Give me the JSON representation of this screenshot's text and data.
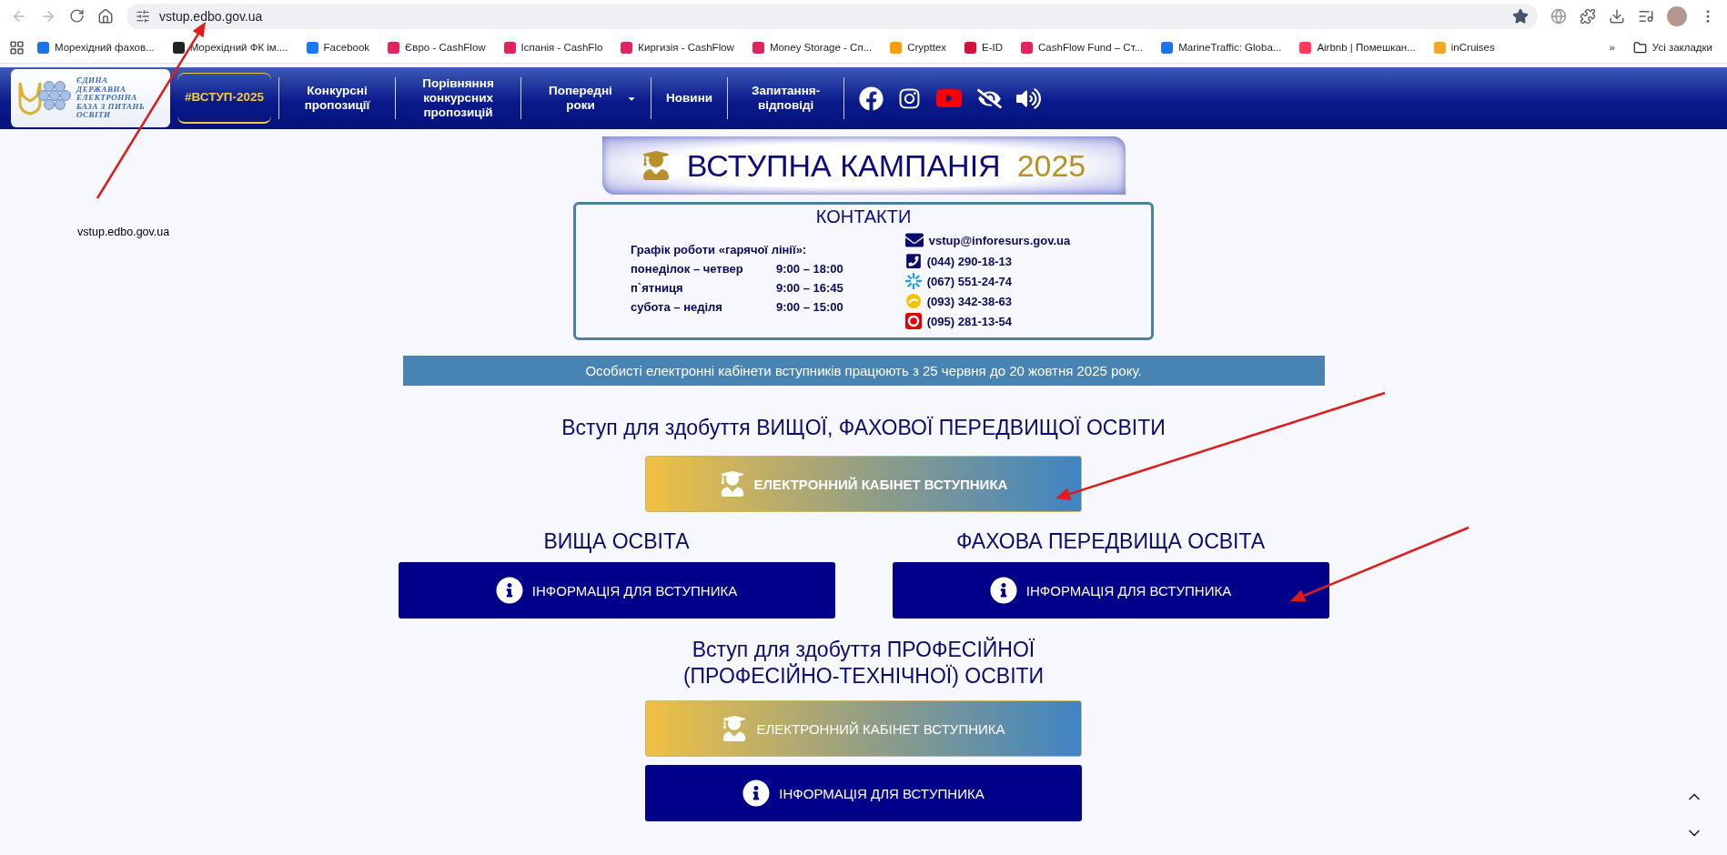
{
  "browser": {
    "url": "vstup.edbo.gov.ua",
    "bookmarks": [
      {
        "label": "Морехідний фахов...",
        "color": "#1a73e8"
      },
      {
        "label": "Морехідний ФК ім....",
        "color": "#222222"
      },
      {
        "label": "Facebook",
        "color": "#1877f2"
      },
      {
        "label": "Євро - CashFlow",
        "color": "#e0245e"
      },
      {
        "label": "Іспанія - CashFlo",
        "color": "#e0245e"
      },
      {
        "label": "Киргизія - CashFlow",
        "color": "#e0245e"
      },
      {
        "label": "Money Storage - Сп...",
        "color": "#e0245e"
      },
      {
        "label": "Crypttex",
        "color": "#f59e0b"
      },
      {
        "label": "E-ID",
        "color": "#d4113b"
      },
      {
        "label": "CashFlow Fund – Ст...",
        "color": "#e0245e"
      },
      {
        "label": "MarineTraffic: Globa...",
        "color": "#1a73e8"
      },
      {
        "label": "Airbnb | Помешкан...",
        "color": "#ff385c"
      },
      {
        "label": "inCruises",
        "color": "#f5a623"
      }
    ],
    "overflow": "»",
    "all_bookmarks": "Усі закладки"
  },
  "site_header": {
    "logo_lines": [
      "ЄДИНА",
      "ДЕРЖАВНА",
      "ЕЛЕКТРОННА",
      "БАЗА З ПИТАНЬ",
      "ОСВІТИ"
    ],
    "nav": [
      {
        "label": "#ВСТУП-2025",
        "selected": true,
        "dropdown": false
      },
      {
        "label": "Конкурсні пропозиції",
        "selected": false,
        "dropdown": false
      },
      {
        "label": "Порівняння конкурсних пропозицій",
        "selected": false,
        "dropdown": false
      },
      {
        "label": "Попередні роки",
        "selected": false,
        "dropdown": true
      },
      {
        "label": "Новини",
        "selected": false,
        "dropdown": false
      },
      {
        "label": "Запитання-відповіді",
        "selected": false,
        "dropdown": false
      }
    ]
  },
  "campaign": {
    "title": "ВСТУПНА КАМПАНІЯ",
    "year": "2025"
  },
  "contacts": {
    "title": "КОНТАКТИ",
    "schedule_title": "Графік роботи «гарячої лінії»:",
    "schedule": [
      {
        "days": "понеділок – четвер",
        "hours": "9:00 – 18:00"
      },
      {
        "days": "п`ятниця",
        "hours": "9:00 – 16:45"
      },
      {
        "days": "субота – неділя",
        "hours": "9:00 – 15:00"
      }
    ],
    "items": [
      {
        "kind": "email",
        "text": "vstup@inforesurs.gov.ua"
      },
      {
        "kind": "phone",
        "text": "(044) 290-18-13"
      },
      {
        "kind": "kyivstar",
        "text": "(067) 551-24-74"
      },
      {
        "kind": "lifecell",
        "text": "(093) 342-38-63"
      },
      {
        "kind": "vodafone",
        "text": "(095) 281-13-54"
      }
    ]
  },
  "notice": "Особисті електронні кабінети вступників працюють з 25 червня до 20 жовтня 2025 року.",
  "higher": {
    "heading": "Вступ для здобуття ВИЩОЇ, ФАХОВОЇ ПЕРЕДВИЩОЇ ОСВІТИ",
    "cabinet_button": "ЕЛЕКТРОННИЙ КАБІНЕТ ВСТУПНИКА",
    "columns": [
      {
        "heading": "ВИЩА ОСВІТА",
        "button": "ІНФОРМАЦІЯ ДЛЯ ВСТУПНИКА"
      },
      {
        "heading": "ФАХОВА ПЕРЕДВИЩА ОСВІТА",
        "button": "ІНФОРМАЦІЯ ДЛЯ ВСТУПНИКА"
      }
    ]
  },
  "vocational": {
    "heading_lines": [
      "Вступ для здобуття ПРОФЕСІЙНОЇ",
      "(ПРОФЕСІЙНО-ТЕХНІЧНОЇ) ОСВІТИ"
    ],
    "cabinet_button": "ЕЛЕКТРОННИЙ КАБІНЕТ ВСТУПНИКА",
    "info_button": "ІНФОРМАЦІЯ ДЛЯ ВСТУПНИКА"
  },
  "annotation": {
    "label": "vstup.edbo.gov.ua"
  }
}
